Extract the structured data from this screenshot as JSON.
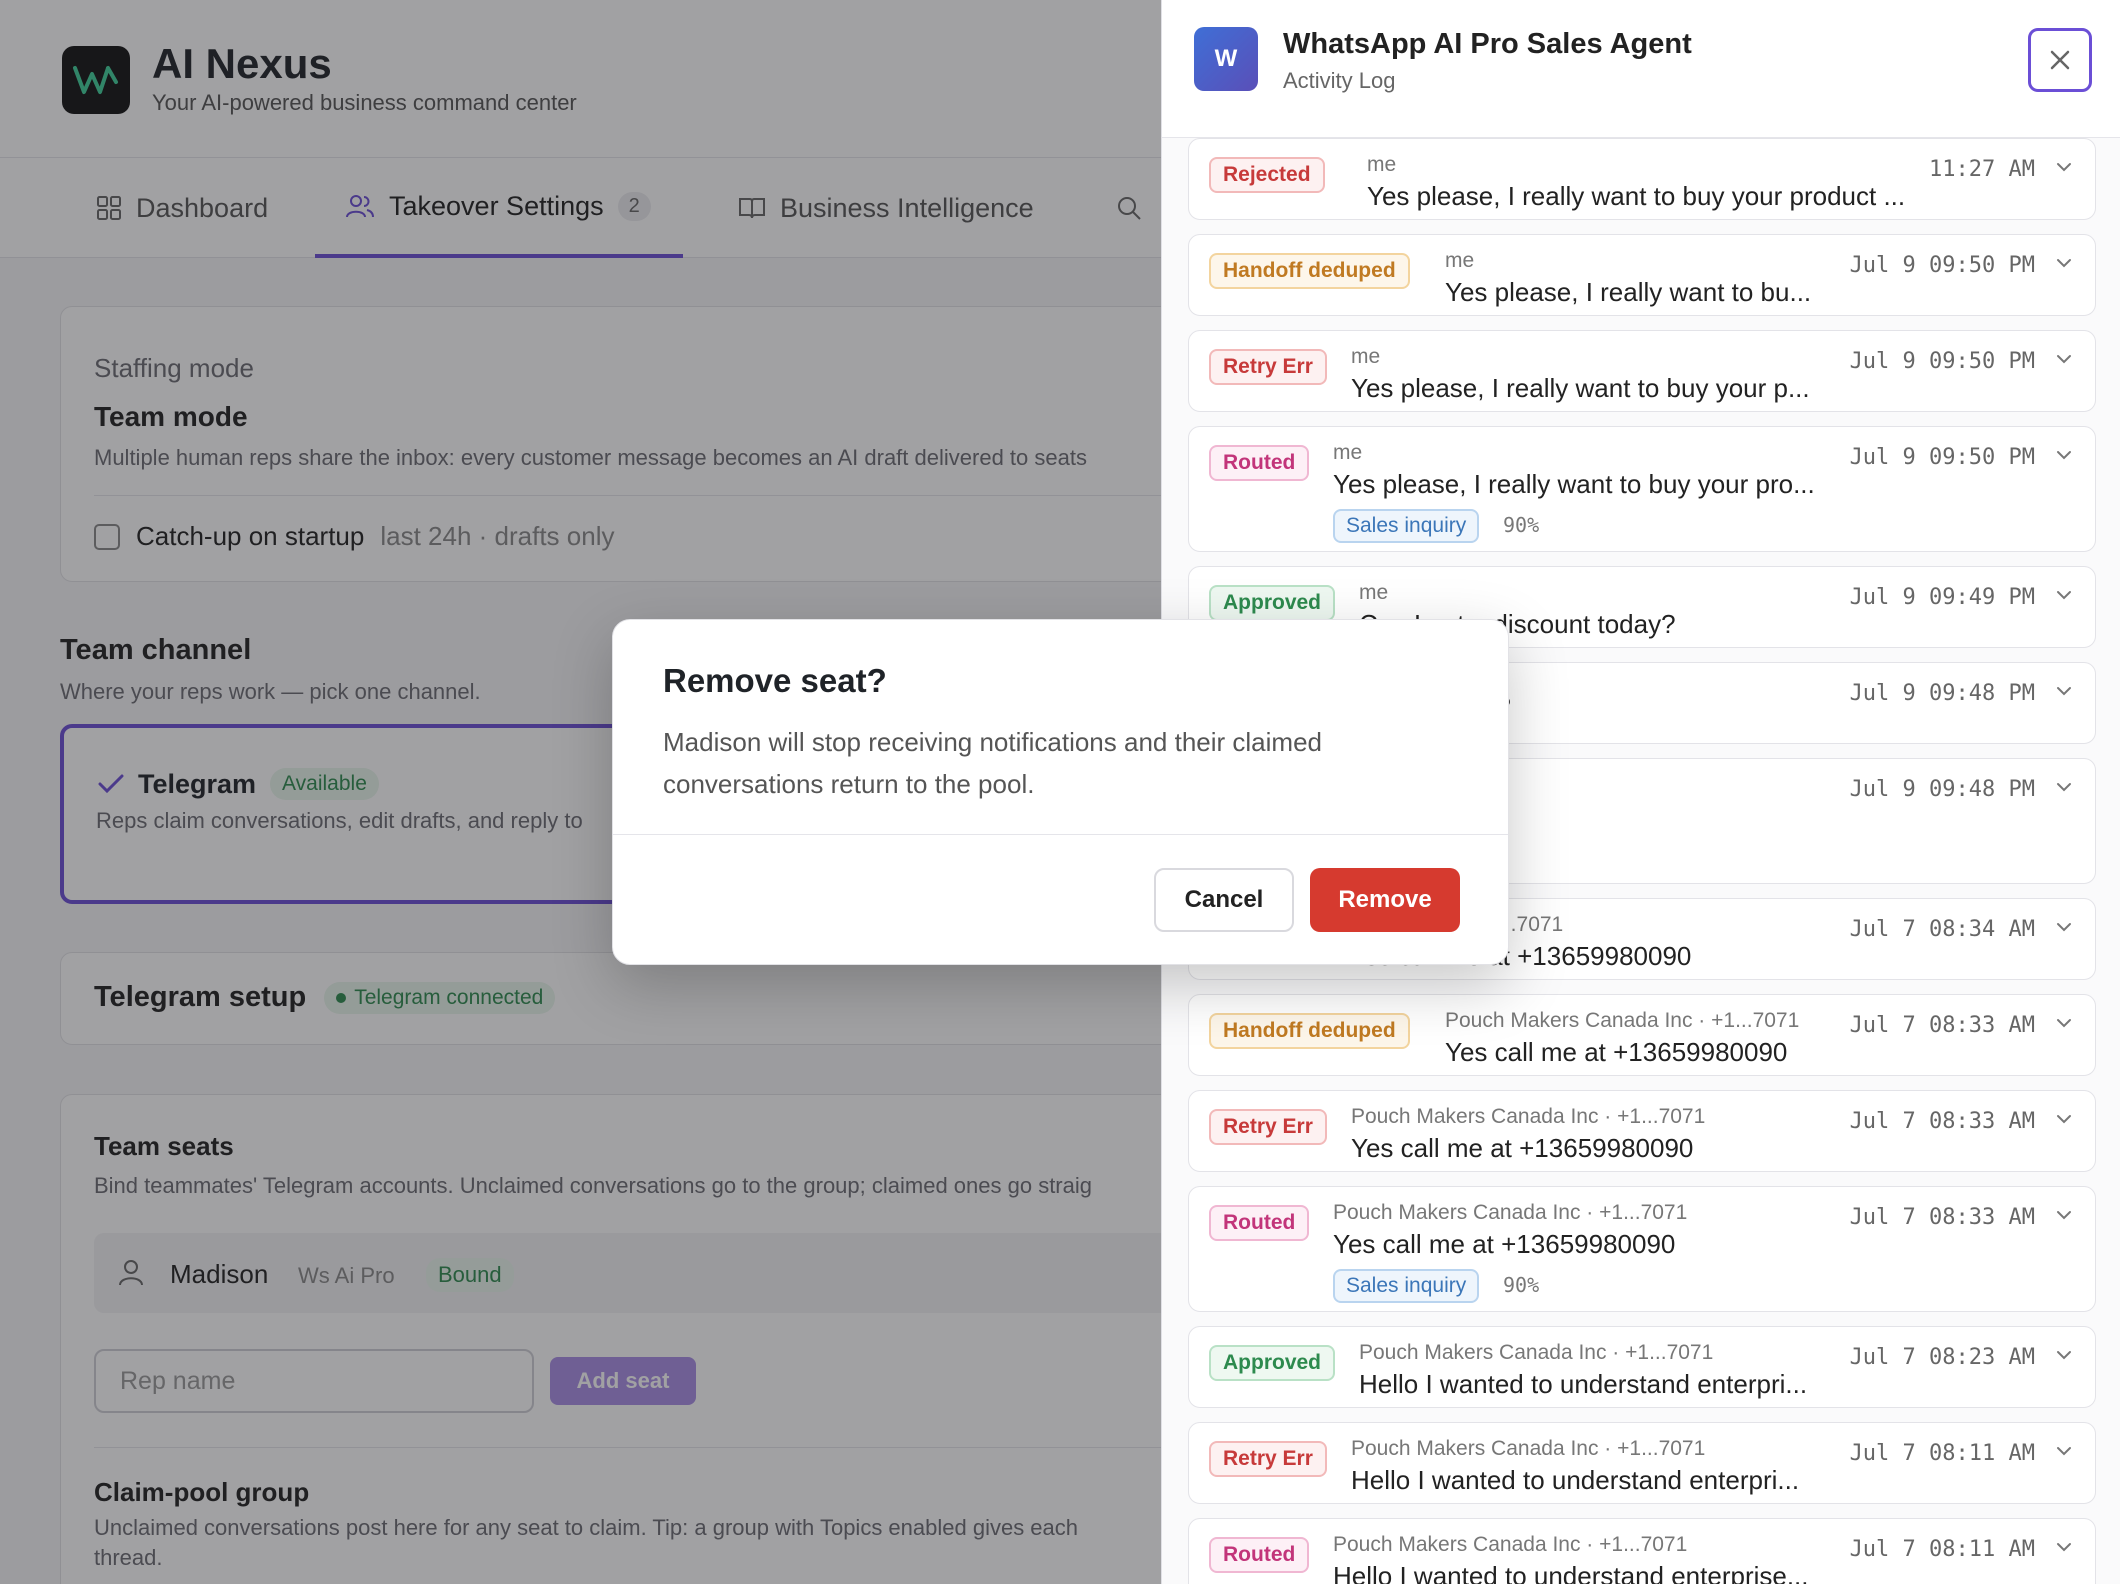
{
  "app": {
    "title": "AI Nexus",
    "subtitle": "Your AI-powered business command center"
  },
  "tabs": [
    {
      "label": "Dashboard",
      "icon": "grid-icon"
    },
    {
      "label": "Takeover Settings",
      "icon": "users-icon",
      "badge": "2",
      "active": true
    },
    {
      "label": "Business Intelligence",
      "icon": "book-icon"
    },
    {
      "label": "",
      "icon": "search-icon"
    }
  ],
  "staffing": {
    "section_label": "Staffing mode",
    "mode_title": "Team mode",
    "mode_desc": "Multiple human reps share the inbox: every customer message becomes an AI draft delivered to seats",
    "catchup_label": "Catch-up on startup",
    "catchup_hint": "last 24h · drafts only",
    "catchup_checked": false
  },
  "team_channel": {
    "title": "Team channel",
    "subtitle": "Where your reps work — pick one channel.",
    "option_name": "Telegram",
    "option_status": "Available",
    "option_desc": "Reps claim conversations, edit drafts, and reply to"
  },
  "telegram_setup": {
    "title": "Telegram setup",
    "status": "Telegram connected"
  },
  "team_seats": {
    "title": "Team seats",
    "desc": "Bind teammates' Telegram accounts. Unclaimed conversations go to the group; claimed ones go straig",
    "seat_name": "Madison",
    "seat_account": "Ws Ai Pro",
    "seat_status": "Bound",
    "rep_placeholder": "Rep name",
    "add_seat_label": "Add seat"
  },
  "claim_pool": {
    "title": "Claim-pool group",
    "desc_line1": "Unclaimed conversations post here for any seat to claim. Tip: a group with Topics enabled gives each",
    "desc_line2": "thread."
  },
  "panel": {
    "avatar_letter": "W",
    "title": "WhatsApp AI Pro Sales Agent",
    "subtitle": "Activity Log",
    "items": [
      {
        "badge": "Rejected",
        "kind": "rejected",
        "sender": "me",
        "message": "Yes please, I really want to buy your product ...",
        "time": "11:27 AM"
      },
      {
        "badge": "Handoff deduped",
        "kind": "handoff",
        "sender": "me",
        "message": "Yes please, I really want to bu...",
        "time": "Jul 9 09:50 PM"
      },
      {
        "badge": "Retry Err",
        "kind": "retry",
        "sender": "me",
        "message": "Yes please, I really want to buy your p...",
        "time": "Jul 9 09:50 PM"
      },
      {
        "badge": "Routed",
        "kind": "routed",
        "sender": "me",
        "message": "Yes please, I really want to buy your pro...",
        "time": "Jul 9 09:50 PM",
        "tag": "Sales inquiry",
        "pct": "90%"
      },
      {
        "badge": "Approved",
        "kind": "approved",
        "sender": "me",
        "message": "Can I get a discount today?",
        "time": "Jul 9 09:49 PM"
      },
      {
        "badge": "",
        "kind": "hidden",
        "sender": "",
        "message": "scount today?",
        "time": "Jul 9 09:48 PM"
      },
      {
        "badge": "",
        "kind": "hidden",
        "sender": "",
        "message": "count today?",
        "time": "Jul 9 09:48 PM",
        "pct": "30%"
      },
      {
        "badge": "",
        "kind": "hidden",
        "sender": "Canada Inc · +1...7071",
        "message": "Yes call me at +13659980090",
        "time": "Jul 7 08:34 AM"
      },
      {
        "badge": "Handoff deduped",
        "kind": "handoff",
        "sender": "Pouch Makers Canada Inc · +1...7071",
        "message": "Yes call me at +13659980090",
        "time": "Jul 7 08:33 AM"
      },
      {
        "badge": "Retry Err",
        "kind": "retry",
        "sender": "Pouch Makers Canada Inc · +1...7071",
        "message": "Yes call me at +13659980090",
        "time": "Jul 7 08:33 AM"
      },
      {
        "badge": "Routed",
        "kind": "routed",
        "sender": "Pouch Makers Canada Inc · +1...7071",
        "message": "Yes call me at +13659980090",
        "time": "Jul 7 08:33 AM",
        "tag": "Sales inquiry",
        "pct": "90%"
      },
      {
        "badge": "Approved",
        "kind": "approved",
        "sender": "Pouch Makers Canada Inc · +1...7071",
        "message": "Hello I wanted to understand enterpri...",
        "time": "Jul 7 08:23 AM"
      },
      {
        "badge": "Retry Err",
        "kind": "retry",
        "sender": "Pouch Makers Canada Inc · +1...7071",
        "message": "Hello I wanted to understand enterpri...",
        "time": "Jul 7 08:11 AM"
      },
      {
        "badge": "Routed",
        "kind": "routed",
        "sender": "Pouch Makers Canada Inc · +1...7071",
        "message": "Hello I wanted to understand enterprise...",
        "time": "Jul 7 08:11 AM"
      }
    ]
  },
  "modal": {
    "title": "Remove seat?",
    "body": "Madison will stop receiving notifications and their claimed conversations return to the pool.",
    "cancel_label": "Cancel",
    "remove_label": "Remove"
  },
  "colors": {
    "accent": "#6b4fd6",
    "danger": "#d63a2f",
    "success": "#2d8a4e"
  }
}
